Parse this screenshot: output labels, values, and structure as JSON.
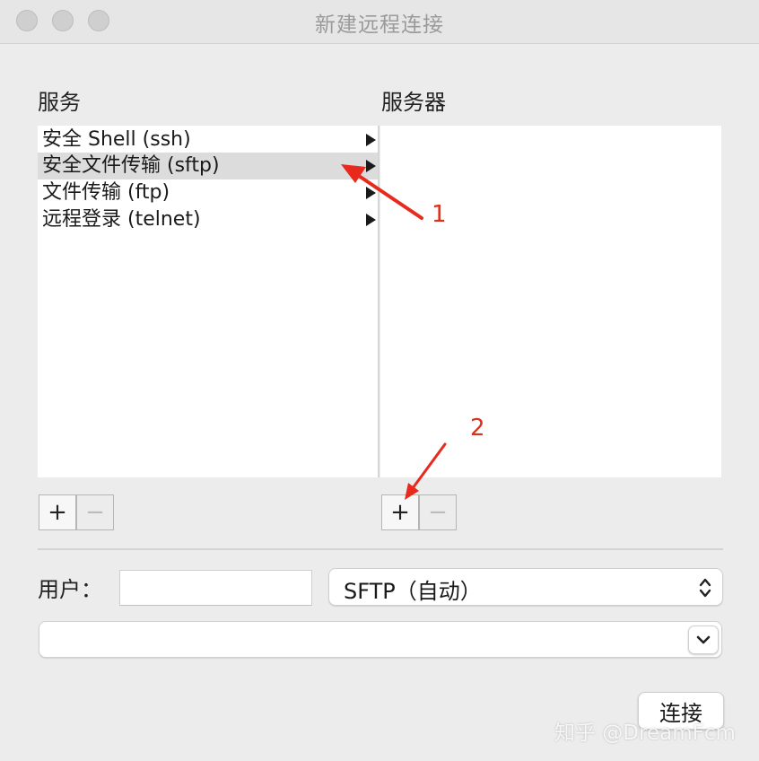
{
  "window": {
    "title": "新建远程连接",
    "traffic_lights": [
      "close",
      "minimize",
      "zoom"
    ]
  },
  "services_panel": {
    "label": "服务",
    "items": [
      {
        "label": "安全 Shell (ssh)",
        "selected": false
      },
      {
        "label": "安全文件传输 (sftp)",
        "selected": true
      },
      {
        "label": "文件传输 (ftp)",
        "selected": false
      },
      {
        "label": "远程登录 (telnet)",
        "selected": false
      }
    ],
    "add_label": "+",
    "remove_label": "−"
  },
  "servers_panel": {
    "label": "服务器",
    "items": [],
    "add_label": "+",
    "remove_label": "−"
  },
  "user": {
    "label": "用户：",
    "value": ""
  },
  "protocol_select": {
    "value": "SFTP（自动）"
  },
  "host_combo": {
    "value": ""
  },
  "connect_button": {
    "label": "连接"
  },
  "annotations": [
    {
      "label": "1",
      "color": "#d6331f"
    },
    {
      "label": "2",
      "color": "#d6331f"
    }
  ],
  "watermark": "知乎 @DreamFcm"
}
